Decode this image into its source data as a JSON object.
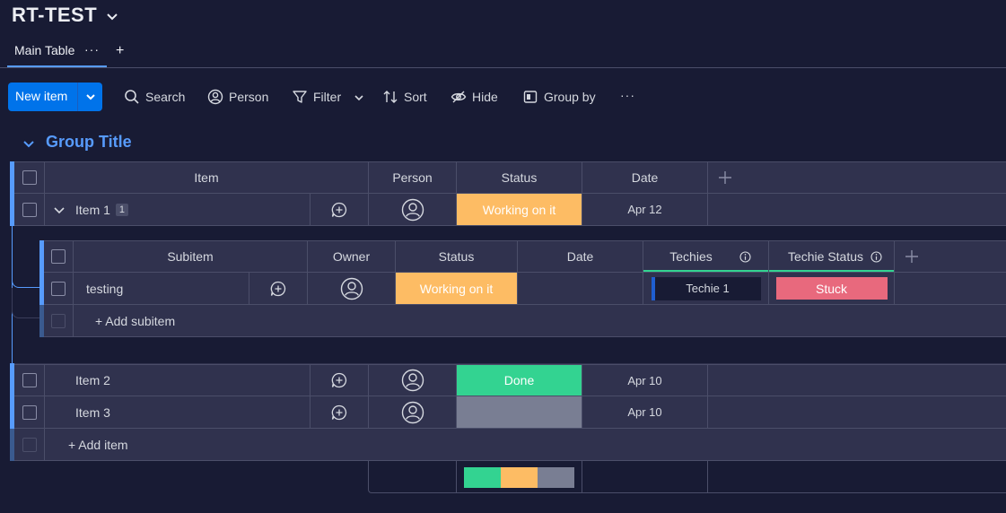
{
  "board": {
    "title": "RT-TEST",
    "view_tab": "Main Table",
    "view_tab_menu": "···",
    "add_view": "+"
  },
  "toolbar": {
    "new_item": "New item",
    "search": "Search",
    "person": "Person",
    "filter": "Filter",
    "sort": "Sort",
    "hide": "Hide",
    "group_by": "Group by",
    "more": "···"
  },
  "group": {
    "title": "Group Title",
    "color": "#579bfc",
    "columns": {
      "item": "Item",
      "person": "Person",
      "status": "Status",
      "date": "Date"
    },
    "items": [
      {
        "name": "Item 1",
        "subitem_count": "1",
        "status": "Working on it",
        "status_color": "#fdbc64",
        "date": "Apr 12"
      },
      {
        "name": "Item 2",
        "status": "Done",
        "status_color": "#33d391",
        "date": "Apr 10"
      },
      {
        "name": "Item 3",
        "status": "",
        "status_color": "#797e93",
        "date": "Apr 10"
      }
    ],
    "add_item": "+ Add item",
    "summary": [
      {
        "status": "Done",
        "color": "#33d391",
        "fraction": 0.3333
      },
      {
        "status": "Working on it",
        "color": "#fdbc64",
        "fraction": 0.3333
      },
      {
        "status": "",
        "color": "#797e93",
        "fraction": 0.3334
      }
    ]
  },
  "subitems": {
    "columns": {
      "subitem": "Subitem",
      "owner": "Owner",
      "status": "Status",
      "date": "Date",
      "techies": "Techies",
      "techie_status": "Techie Status"
    },
    "rows": [
      {
        "name": "testing",
        "status": "Working on it",
        "status_color": "#fdbc64",
        "date": "",
        "techie": "Techie 1",
        "techie_status": "Stuck",
        "techie_status_color": "#e8697d"
      }
    ],
    "add_subitem": "+ Add subitem"
  },
  "colors": {
    "background": "#181b34",
    "row": "#30324e",
    "border": "#4b4e69",
    "primary": "#0073ea"
  }
}
